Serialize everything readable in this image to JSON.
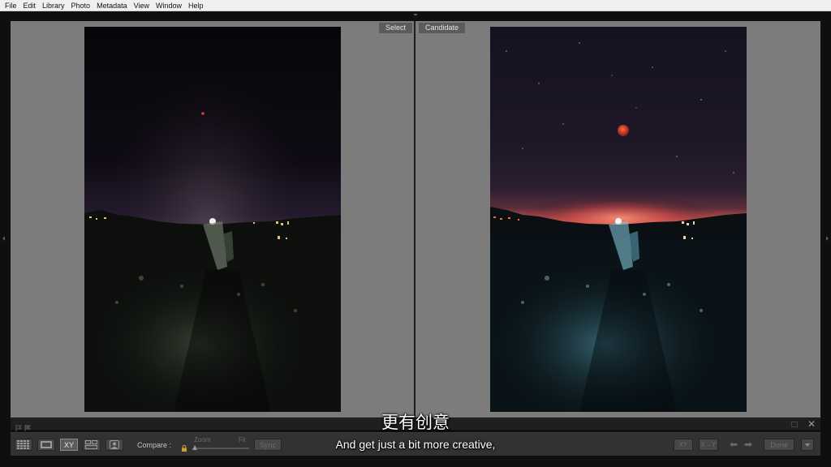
{
  "menu": [
    "File",
    "Edit",
    "Library",
    "Photo",
    "Metadata",
    "View",
    "Window",
    "Help"
  ],
  "compare": {
    "select_label": "Select",
    "candidate_label": "Candidate"
  },
  "toolbar": {
    "grid_view_icon": "grid-icon",
    "loupe_view_icon": "loupe-icon",
    "compare_view_label": "XY",
    "survey_view_icon": "survey-icon",
    "people_view_icon": "face-icon",
    "compare_label": "Compare :",
    "lock_icon": "lock-icon",
    "zoom_label": "Zoom",
    "fit_label": "Fit",
    "sync_label": "Sync",
    "swap_label": "XY",
    "make_select_label": "X→Y",
    "prev_icon": "arrow-left-icon",
    "next_icon": "arrow-right-icon",
    "done_label": "Done",
    "close_icon": "close-icon"
  },
  "subtitles": {
    "chinese": "更有创意",
    "english": "And get just a bit more creative,"
  },
  "colors": {
    "menubar": "#f0f0f0",
    "background": "#7a7a7a",
    "label_bg": "#5b5b5b"
  }
}
